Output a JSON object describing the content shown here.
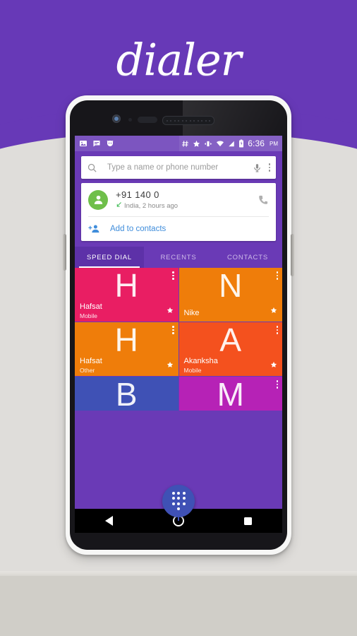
{
  "promo": {
    "title": "dialer",
    "banner_color": "#6739b7",
    "background_color": "#dfdddA"
  },
  "statusbar": {
    "icons_left": [
      "image-icon",
      "message-icon",
      "cyanogenmod-icon"
    ],
    "icons_right": [
      "hashtag-icon",
      "star-icon",
      "vibrate-icon",
      "wifi-icon",
      "signal-icon",
      "battery-charging-icon"
    ],
    "time": "6:36",
    "meridiem": "PM"
  },
  "search": {
    "placeholder": "Type a name or phone number",
    "search_icon": "search-icon",
    "mic_icon": "microphone-icon",
    "overflow_icon": "overflow-menu-icon"
  },
  "call_card": {
    "number": "+91 140 0",
    "subtitle": "India, 2 hours ago",
    "direction_icon": "incoming-call-arrow-icon",
    "call_icon": "phone-handset-icon",
    "avatar_icon": "person-icon",
    "avatar_color": "#6fbf4a",
    "add_contact_label": "Add to contacts",
    "add_contact_icon": "add-person-icon",
    "add_contact_color": "#3f8ddb"
  },
  "tabs": [
    {
      "label": "SPEED DIAL",
      "active": true
    },
    {
      "label": "RECENTS",
      "active": false
    },
    {
      "label": "CONTACTS",
      "active": false
    }
  ],
  "speed_dial": [
    {
      "letter": "H",
      "name": "Hafsat",
      "type": "Mobile",
      "color": "#e91e63",
      "starred": true
    },
    {
      "letter": "N",
      "name": "Nike",
      "type": "",
      "color": "#ef7d0a",
      "starred": true
    },
    {
      "letter": "H",
      "name": "Hafsat",
      "type": "Other",
      "color": "#ef7d0a",
      "starred": true
    },
    {
      "letter": "A",
      "name": "Akanksha",
      "type": "Mobile",
      "color": "#f4511e",
      "starred": true
    },
    {
      "letter": "B",
      "name": "",
      "type": "",
      "color": "#3f51b5",
      "starred": false
    },
    {
      "letter": "M",
      "name": "",
      "type": "",
      "color": "#b622b6",
      "starred": false
    }
  ],
  "fab": {
    "icon": "dialpad-icon",
    "color": "#3f51b5"
  },
  "navbar": {
    "back": "back-icon",
    "home": "home-icon",
    "recents": "recents-icon"
  },
  "theme": {
    "primary": "#6739b7",
    "primary_light": "#7c55c0",
    "tab_active_bg": "#5d31a8"
  }
}
